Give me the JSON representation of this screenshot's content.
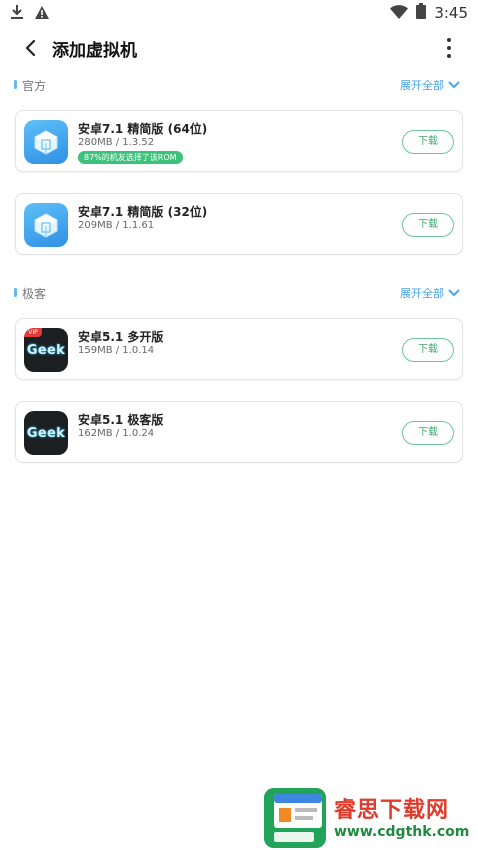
{
  "status_bar": {
    "time": "3:45",
    "left_icons": [
      "download-icon",
      "warning-icon"
    ],
    "right_icons": [
      "wifi-icon",
      "battery-icon"
    ]
  },
  "header": {
    "title": "添加虚拟机",
    "back_icon": "back-arrow-icon",
    "more_icon": "more-vertical-icon"
  },
  "sections": [
    {
      "title": "官方",
      "expand_label": "展开全部",
      "items": [
        {
          "name": "安卓7.1 精简版 (64位)",
          "meta": "280MB / 1.3.52",
          "badge": "87%的机友选择了该ROM",
          "button": "下载",
          "icon": "vm-cube-icon"
        },
        {
          "name": "安卓7.1 精简版 (32位)",
          "meta": "209MB / 1.1.61",
          "button": "下载",
          "icon": "vm-cube-icon"
        }
      ]
    },
    {
      "title": "极客",
      "expand_label": "展开全部",
      "items": [
        {
          "name": "安卓5.1 多开版",
          "meta": "159MB / 1.0.14",
          "button": "下载",
          "icon": "geek-icon",
          "icon_text": "Geek",
          "icon_tag": "VIP"
        },
        {
          "name": "安卓5.1 极客版",
          "meta": "162MB / 1.0.24",
          "button": "下载",
          "icon": "geek-icon",
          "icon_text": "Geek"
        }
      ]
    }
  ],
  "watermark": {
    "title": "睿思下载网",
    "url": "www.cdgthk.com"
  },
  "colors": {
    "accent_blue": "#4aa3e8",
    "download_green": "#3fa872",
    "badge_green": "#3cc27a"
  }
}
